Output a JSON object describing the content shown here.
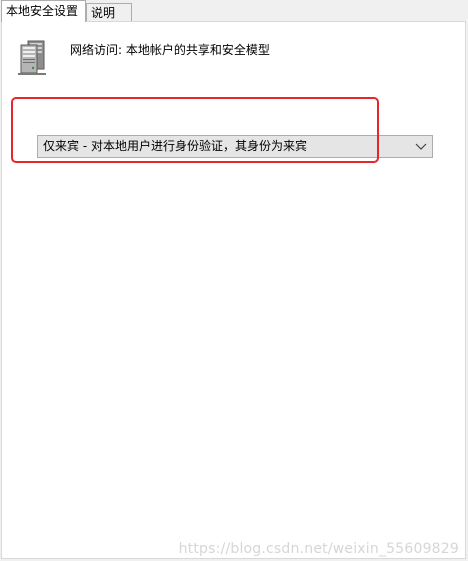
{
  "tabs": [
    {
      "label": "本地安全设置",
      "active": true
    },
    {
      "label": "说明",
      "active": false
    }
  ],
  "policy": {
    "title": "网络访问: 本地帐户的共享和安全模型",
    "icon": "server-policy-icon"
  },
  "setting": {
    "selected_value": "仅来宾 - 对本地用户进行身份验证，其身份为来宾"
  },
  "annotation": {
    "color": "#e8262a"
  },
  "watermark": "https://blog.csdn.net/weixin_55609829"
}
